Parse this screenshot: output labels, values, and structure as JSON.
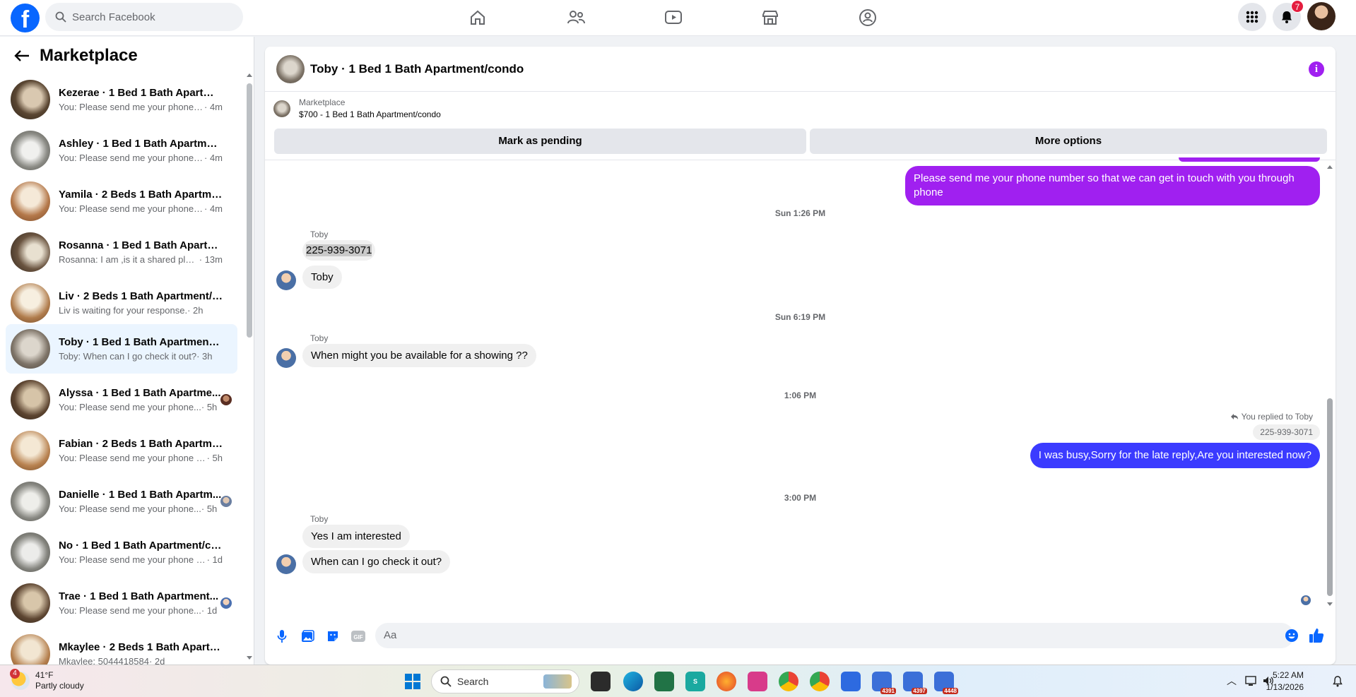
{
  "topbar": {
    "search_placeholder": "Search Facebook",
    "notifications_count": "7"
  },
  "sidebar": {
    "title": "Marketplace",
    "conversations": [
      {
        "name": "Kezerae · 1 Bed 1 Bath Apartmen...",
        "snippet": "You: Please send me your phone n...",
        "time": " · 4m"
      },
      {
        "name": "Ashley · 1 Bed 1 Bath Apartment...",
        "snippet": "You: Please send me your phone n...",
        "time": " · 4m"
      },
      {
        "name": "Yamila · 2 Beds 1 Bath Apartmen...",
        "snippet": "You: Please send me your phone n...",
        "time": " · 4m"
      },
      {
        "name": "Rosanna · 1 Bed 1 Bath Apartme...",
        "snippet": "Rosanna: I am ,is it a shared place...",
        "time": " · 13m"
      },
      {
        "name": "Liv · 2 Beds 1 Bath Apartment/c...",
        "snippet": "Liv is waiting for your response.",
        "time": " · 2h"
      },
      {
        "name": "Toby · 1 Bed 1 Bath Apartment/c...",
        "snippet": "Toby: When can I go check it out?",
        "time": " · 3h"
      },
      {
        "name": "Alyssa · 1 Bed 1 Bath Apartme...",
        "snippet": "You: Please send me your phone...",
        "time": " · 5h"
      },
      {
        "name": "Fabian · 2 Beds 1 Bath Apartmen...",
        "snippet": "You: Please send me your phone nu...",
        "time": " · 5h"
      },
      {
        "name": "Danielle · 1 Bed 1 Bath Apartm...",
        "snippet": "You: Please send me your phone...",
        "time": " · 5h"
      },
      {
        "name": "No · 1 Bed 1 Bath Apartment/co...",
        "snippet": "You: Please send me your phone n...",
        "time": " · 1d"
      },
      {
        "name": "Trae · 1 Bed 1 Bath Apartment...",
        "snippet": "You: Please send me your phone...",
        "time": " · 1d"
      },
      {
        "name": "Mkaylee · 2 Beds 1 Bath Apartm...",
        "snippet": "Mkaylee: 5044418584",
        "time": " · 2d"
      }
    ]
  },
  "chat": {
    "title": "Toby · 1 Bed 1 Bath Apartment/condo",
    "listing_label": "Marketplace",
    "listing_title": "$700 - 1 Bed 1 Bath Apartment/condo",
    "mark_pending": "Mark as pending",
    "more_options": "More options",
    "messages": {
      "out_1": "Please send me your phone  number so that we can get in touch with you through phone",
      "ts_1": "Sun 1:26 PM",
      "sender": "Toby",
      "in_phone": "225-939-3071",
      "in_name": "Toby",
      "ts_2": "Sun 6:19 PM",
      "in_showing": "When might you be available for a showing ??",
      "ts_3": "1:06 PM",
      "replied_to": "You replied to Toby",
      "quoted": "225-939-3071",
      "out_2": "I was busy,Sorry for the late reply,Are you interested now?",
      "ts_4": "3:00 PM",
      "in_interested": "Yes I am interested",
      "in_check": "When can I go check it out?"
    },
    "composer_placeholder": "Aa"
  },
  "taskbar": {
    "weather_temp": "41°F",
    "weather_desc": "Partly cloudy",
    "weather_badge": "4",
    "search_label": "Search",
    "time": "5:22 AM",
    "date": "1/13/2026",
    "app_counts": [
      "4391",
      "4397",
      "4448"
    ]
  }
}
